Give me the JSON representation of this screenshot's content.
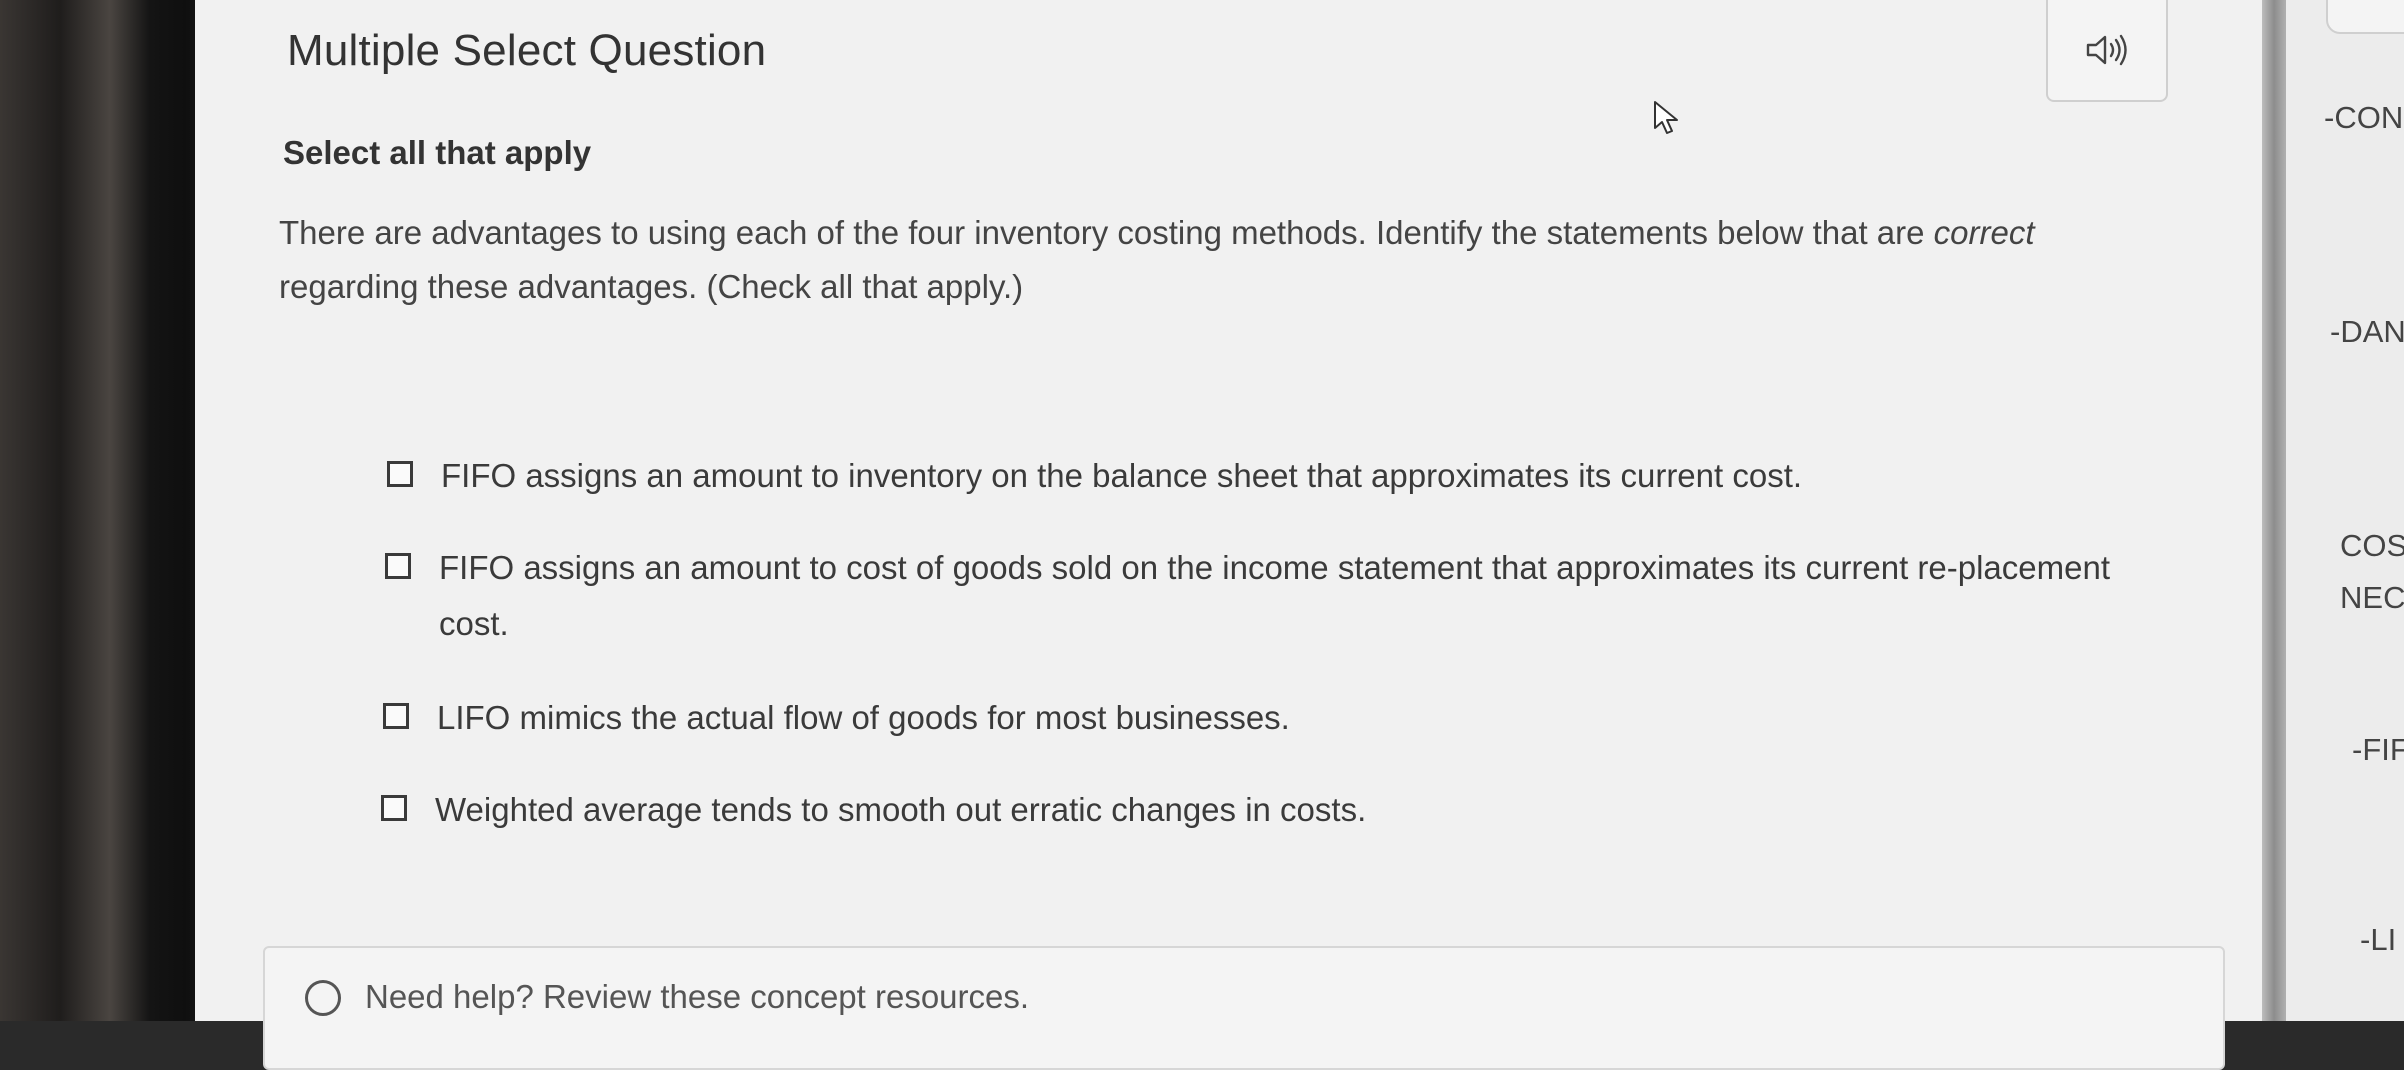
{
  "question": {
    "type_label": "Multiple Select Question",
    "instruction": "Select all that apply",
    "prompt_part1": "There are advantages to using each of the four inventory costing methods. Identify the statements below that are",
    "prompt_emphasis": "correct",
    "prompt_part2": "regarding these advantages. (Check all that apply.)"
  },
  "options": [
    {
      "text": "FIFO assigns an amount to inventory on the balance sheet that approximates its current cost.",
      "checked": false
    },
    {
      "text": "FIFO assigns an amount to cost of goods sold on the income statement that approximates its current re-placement cost.",
      "checked": false
    },
    {
      "text": "LIFO mimics the actual flow of goods for most businesses.",
      "checked": false
    },
    {
      "text": "Weighted average tends to smooth out erratic changes in costs.",
      "checked": false
    }
  ],
  "help": {
    "text": "Need help? Review these concept resources."
  },
  "side_panel": {
    "items": [
      "-CON",
      "-DAN",
      "COS",
      "NEC",
      "-FIF",
      "-LI"
    ]
  },
  "icons": {
    "audio": "speaker-icon",
    "cursor": "mouse-pointer-icon",
    "help": "help-circle-icon"
  }
}
